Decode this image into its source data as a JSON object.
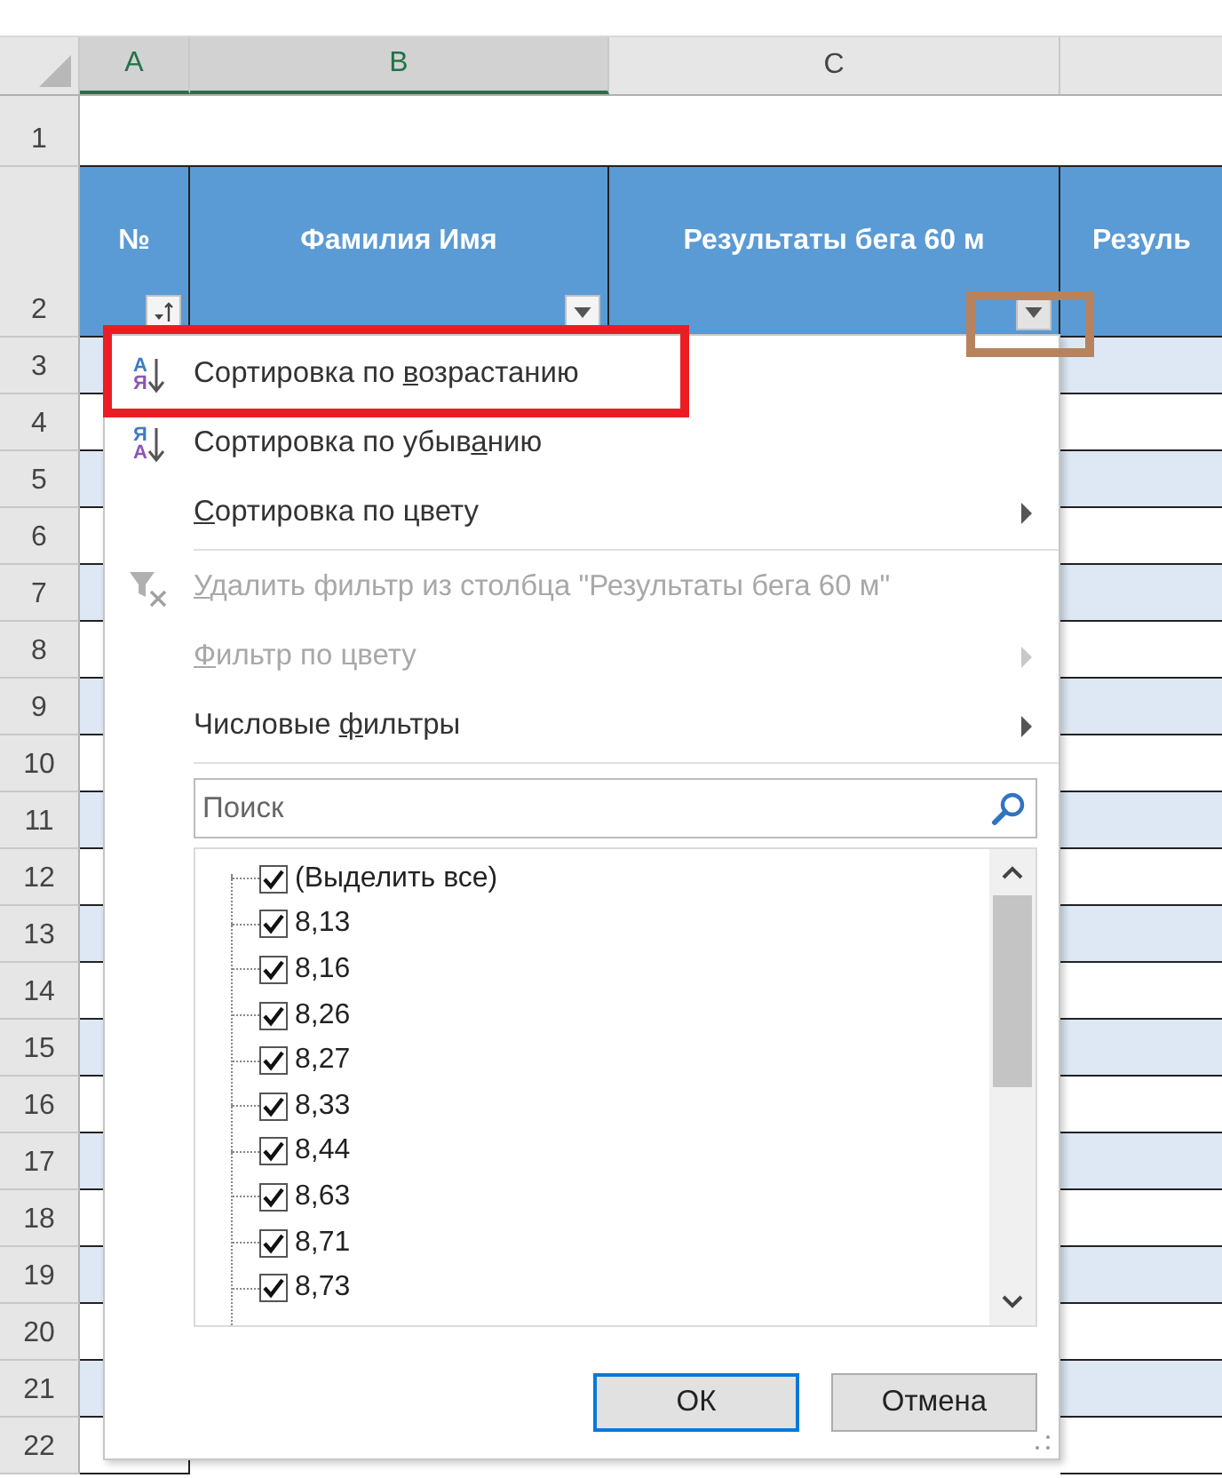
{
  "sheet": {
    "column_headers": [
      {
        "label": "A",
        "selected": true
      },
      {
        "label": "B",
        "selected": true
      },
      {
        "label": "C",
        "selected": false
      }
    ],
    "row_numbers": [
      "1",
      "2",
      "3",
      "4",
      "5",
      "6",
      "7",
      "8",
      "9",
      "10",
      "11",
      "12",
      "13",
      "14",
      "15",
      "16",
      "17",
      "18",
      "19",
      "20",
      "21",
      "22"
    ],
    "header_cells": [
      {
        "text": "№",
        "kind": "sorted"
      },
      {
        "text": "Фамилия Имя",
        "kind": "dropdown"
      },
      {
        "text": "Результаты бега 60 м",
        "kind": "dropdown"
      },
      {
        "text": "Резуль"
      }
    ]
  },
  "filter_menu": {
    "items": [
      {
        "kind": "sort",
        "icon_letters": [
          "А",
          "Я"
        ],
        "before": "Сортировка по ",
        "key": "в",
        "after": "озрастанию",
        "disabled": false,
        "submenu": false
      },
      {
        "kind": "sort",
        "icon_letters": [
          "Я",
          "А"
        ],
        "before": "Сортировка по убыв",
        "key": "а",
        "after": "нию",
        "disabled": false,
        "submenu": false
      },
      {
        "kind": "plain",
        "key": "С",
        "after": "ортировка по цвету",
        "disabled": false,
        "submenu": true
      },
      {
        "kind": "separator"
      },
      {
        "kind": "clear",
        "key": "У",
        "after": "далить фильтр из столбца \"Результаты бега 60 м\"",
        "disabled": true,
        "submenu": false
      },
      {
        "kind": "plain",
        "key": "Ф",
        "after": "ильтр по цвету",
        "disabled": true,
        "submenu": true
      },
      {
        "kind": "plain",
        "before": "Числовые ",
        "key": "ф",
        "after": "ильтры",
        "disabled": false,
        "submenu": true
      },
      {
        "kind": "separator"
      }
    ],
    "search": {
      "placeholder": "Поиск"
    },
    "values": [
      {
        "label": "(Выделить все)",
        "checked": true
      },
      {
        "label": "8,13",
        "checked": true
      },
      {
        "label": "8,16",
        "checked": true
      },
      {
        "label": "8,26",
        "checked": true
      },
      {
        "label": "8,27",
        "checked": true
      },
      {
        "label": "8,33",
        "checked": true
      },
      {
        "label": "8,44",
        "checked": true
      },
      {
        "label": "8,63",
        "checked": true
      },
      {
        "label": "8,71",
        "checked": true
      },
      {
        "label": "8,73",
        "checked": true
      }
    ],
    "buttons": [
      {
        "label": "ОК",
        "default": true
      },
      {
        "label": "Отмена",
        "default": false
      }
    ]
  },
  "annotations": [
    {
      "kind": "item_frame",
      "color": "#ec1c24"
    },
    {
      "kind": "button_frame",
      "color": "#b7835f"
    }
  ]
}
